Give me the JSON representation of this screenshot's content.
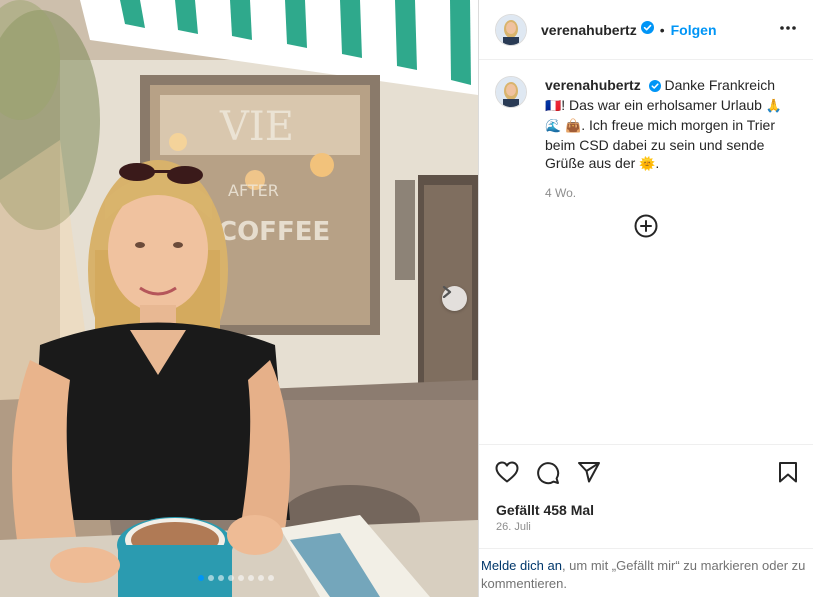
{
  "post": {
    "username": "verenahubertz",
    "follow_label": "Folgen",
    "separator": "•",
    "caption_text_1": "Danke Frankreich",
    "caption_text_2": "! Das war ein erholsamer Urlaub",
    "caption_text_3": ". Ich freue mich morgen in Trier beim CSD dabei zu sein und sende Grüße aus der",
    "caption_text_4": ".",
    "emoji_flag": "🇫🇷",
    "emoji_pray": "🙏",
    "emoji_wave": "🌊",
    "emoji_bag": "👜",
    "emoji_sun": "🌞",
    "age": "4 Wo.",
    "likes": "Gefällt 458 Mal",
    "date": "26. Juli",
    "login_link": "Melde dich an",
    "login_text": ", um mit „Gefällt mir“ zu markieren oder zu kommentieren.",
    "photo_sign_text": "VIE",
    "photo_coffee_text": "COFFEE",
    "photo_after_text": "AFTER",
    "carousel_count": 8,
    "carousel_active": 0
  },
  "icons": {
    "verified": "verified-badge-icon",
    "more": "more-options-icon",
    "add": "add-comment-icon",
    "like": "heart-icon",
    "comment": "comment-icon",
    "share": "share-icon",
    "save": "bookmark-icon",
    "next": "chevron-right-icon"
  },
  "colors": {
    "accent": "#0095f6",
    "text": "#262626",
    "muted": "#8e8e8e",
    "link": "#00376b"
  }
}
